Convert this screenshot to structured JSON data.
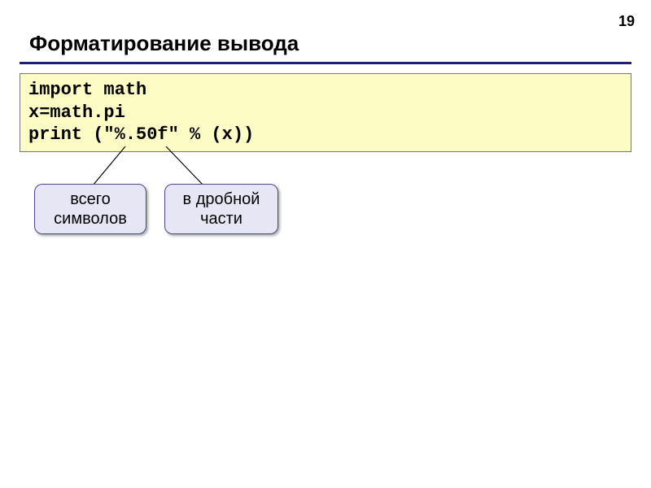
{
  "page": {
    "number": "19"
  },
  "heading": "Форматирование вывода",
  "code": {
    "line1": "import math",
    "line2": "x=math.pi",
    "line3": "print (\"%.50f\" % (x))"
  },
  "callouts": {
    "total": {
      "line1": "всего",
      "line2": "символов"
    },
    "fraction": {
      "line1": "в дробной",
      "line2": "части"
    }
  }
}
